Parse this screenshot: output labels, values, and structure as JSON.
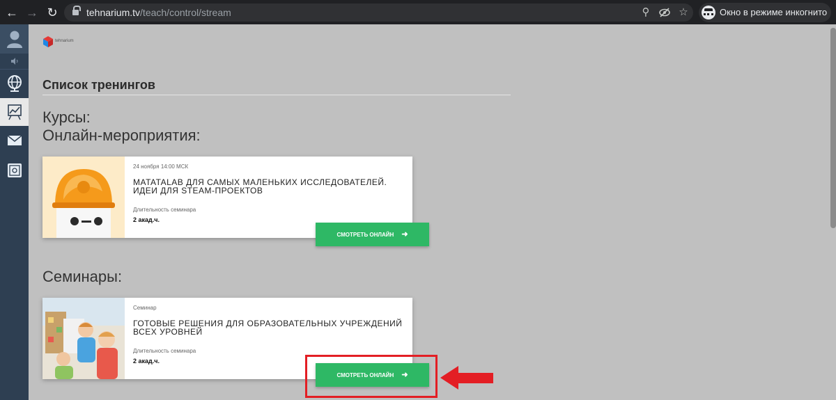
{
  "browser": {
    "url_domain": "tehnarium.tv",
    "url_path": "/teach/control/stream",
    "incognito_label": "Окно в режиме инкогнито",
    "icons": [
      "back-arrow-icon",
      "forward-arrow-icon",
      "reload-icon",
      "lock-icon",
      "zoom-icon",
      "eye-off-icon",
      "star-icon",
      "incognito-icon"
    ]
  },
  "sidebar": {
    "icons": [
      "user-avatar-icon",
      "sound-icon",
      "globe-icon",
      "chart-icon",
      "mail-icon",
      "safe-icon"
    ],
    "active_item": "chart-icon"
  },
  "page": {
    "title": "Список тренингов",
    "sections": {
      "courses": "Курсы:",
      "online_events": "Онлайн-мероприятия:",
      "seminars": "Семинары:"
    }
  },
  "cards": [
    {
      "meta": "24 ноября 14:00 МСК",
      "title": "MATATALAB для самых маленьких исследователей. Идеи для STEAM-проектов",
      "duration_label": "Длительность семинара",
      "duration": "2 акад.ч.",
      "button_label": "СМОТРЕТЬ ОНЛАЙН"
    },
    {
      "meta": "Семинар",
      "title": "Готовые решения для образовательных учреждений всех уровней",
      "duration_label": "Длительность семинара",
      "duration": "2 акад.ч.",
      "button_label": "СМОТРЕТЬ ОНЛАЙН"
    }
  ],
  "colors": {
    "page_bg": "#c0c0c0",
    "sidebar_bg": "#2e3f52",
    "button_green": "#2eb865",
    "annotation_red": "#e31e24"
  }
}
